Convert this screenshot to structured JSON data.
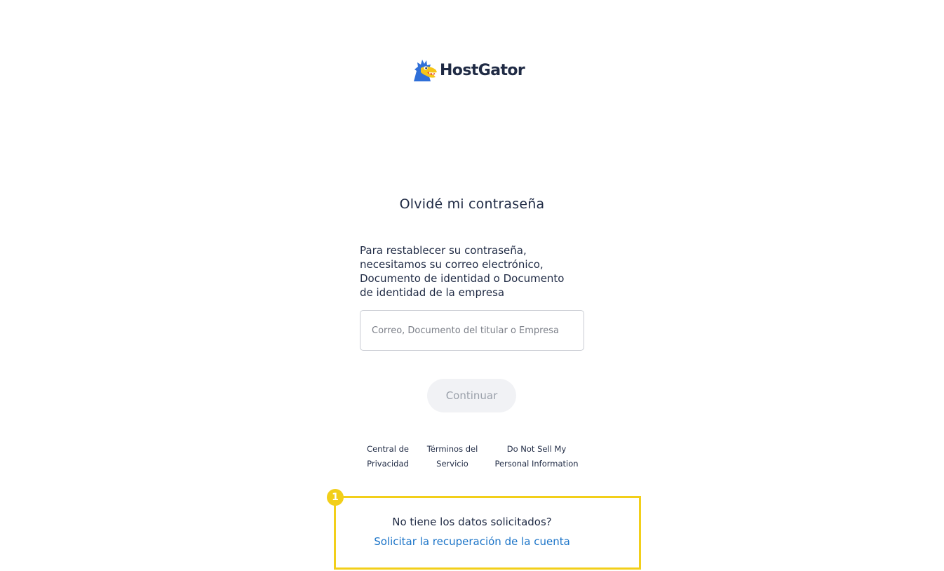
{
  "brand": {
    "name": "HostGator",
    "logo_icon": "gator-mascot-icon"
  },
  "form": {
    "title": "Olvidé mi contraseña",
    "description_lines": [
      "Para restablecer su contraseña,",
      "necesitamos su correo electrónico,",
      "Documento de identidad o Documento",
      "de identidad de la empresa"
    ],
    "input": {
      "value": "",
      "placeholder": "Correo, Documento del titular o Empresa"
    },
    "continue_label": "Continuar"
  },
  "footer": {
    "links": [
      {
        "lines": [
          "Central de",
          "Privacidad"
        ]
      },
      {
        "lines": [
          "Términos del",
          "Servicio"
        ]
      },
      {
        "lines": [
          "Do Not Sell My",
          "Personal Information"
        ]
      }
    ]
  },
  "help": {
    "badge": "1",
    "question": "No tiene los datos solicitados?",
    "link_label": "Solicitar la recuperación de la cuenta"
  },
  "colors": {
    "text_dark": "#1f2a44",
    "link_blue": "#1b74c8",
    "highlight_yellow": "#f2cf1a",
    "button_disabled_bg": "#f1f2f5",
    "button_disabled_text": "#9aa0aa",
    "logo_blue": "#2f6fd8",
    "logo_yellow": "#f5c518"
  }
}
